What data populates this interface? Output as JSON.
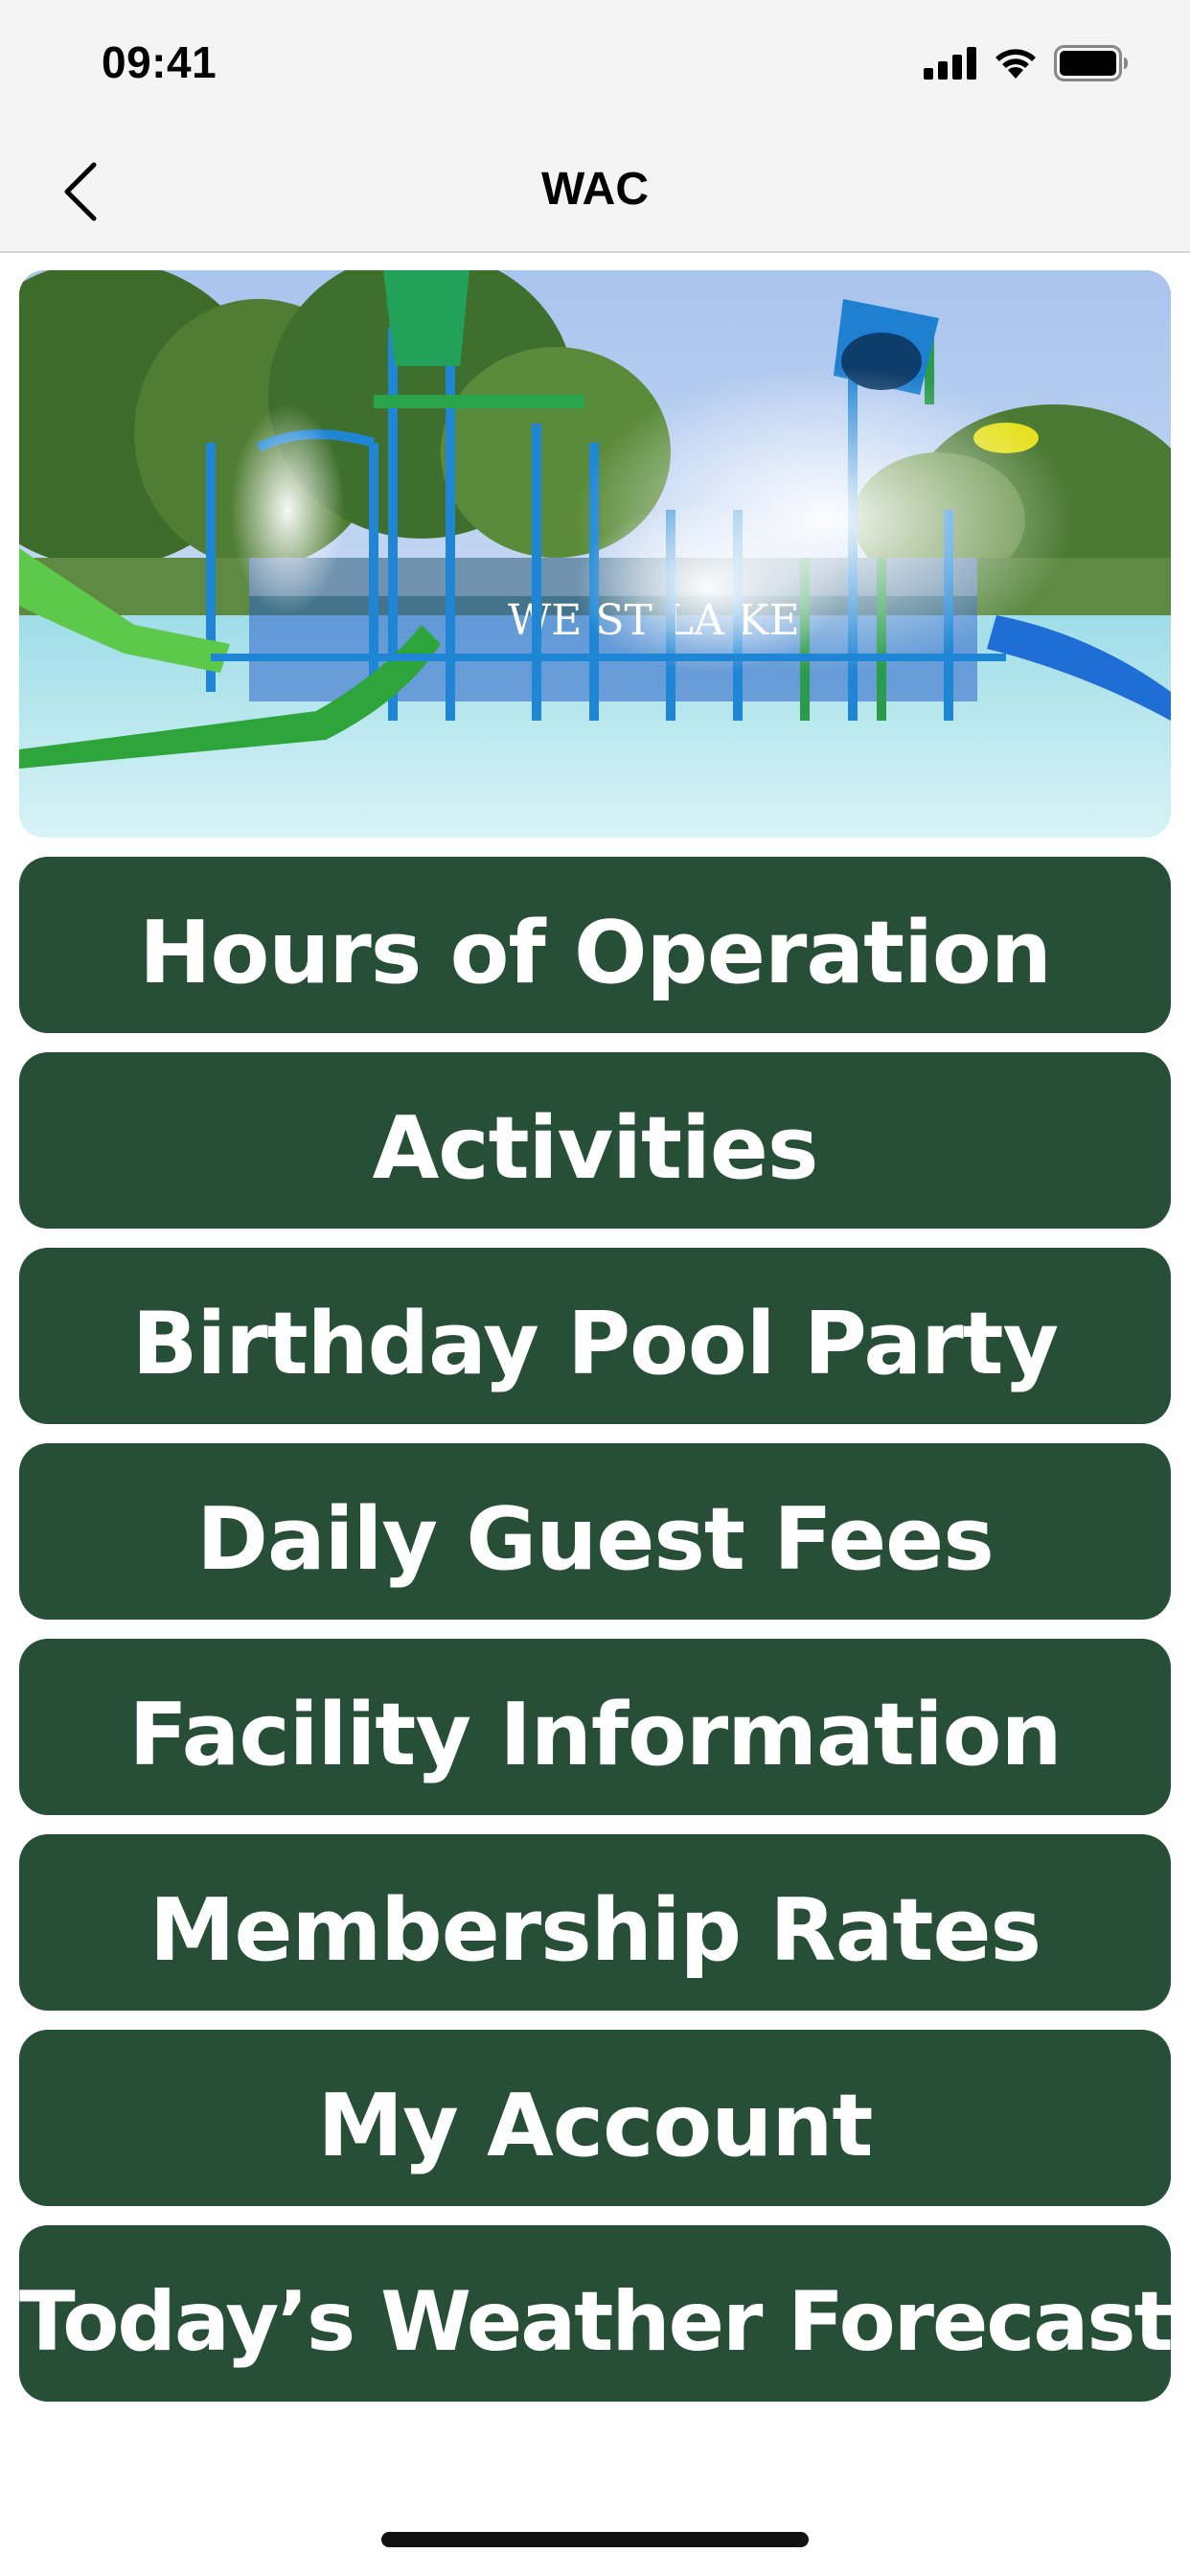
{
  "status_bar": {
    "time": "09:41",
    "icons": [
      "signal-icon",
      "wifi-icon",
      "battery-icon"
    ]
  },
  "nav": {
    "title": "WAC",
    "back_icon": "chevron-left-icon"
  },
  "hero": {
    "description_icon": "water-park-photo",
    "sign_text": "WE ST LA KE"
  },
  "menu": {
    "items": [
      {
        "label": "Hours of Operation"
      },
      {
        "label": "Activities"
      },
      {
        "label": "Birthday Pool Party"
      },
      {
        "label": "Daily Guest Fees"
      },
      {
        "label": "Facility Information"
      },
      {
        "label": "Membership Rates"
      },
      {
        "label": "My Account"
      },
      {
        "label": "Today’s Weather Forecast"
      }
    ]
  },
  "colors": {
    "button_bg": "#274e36",
    "button_text": "#ffffff",
    "bar_bg": "#f4f4f4"
  }
}
